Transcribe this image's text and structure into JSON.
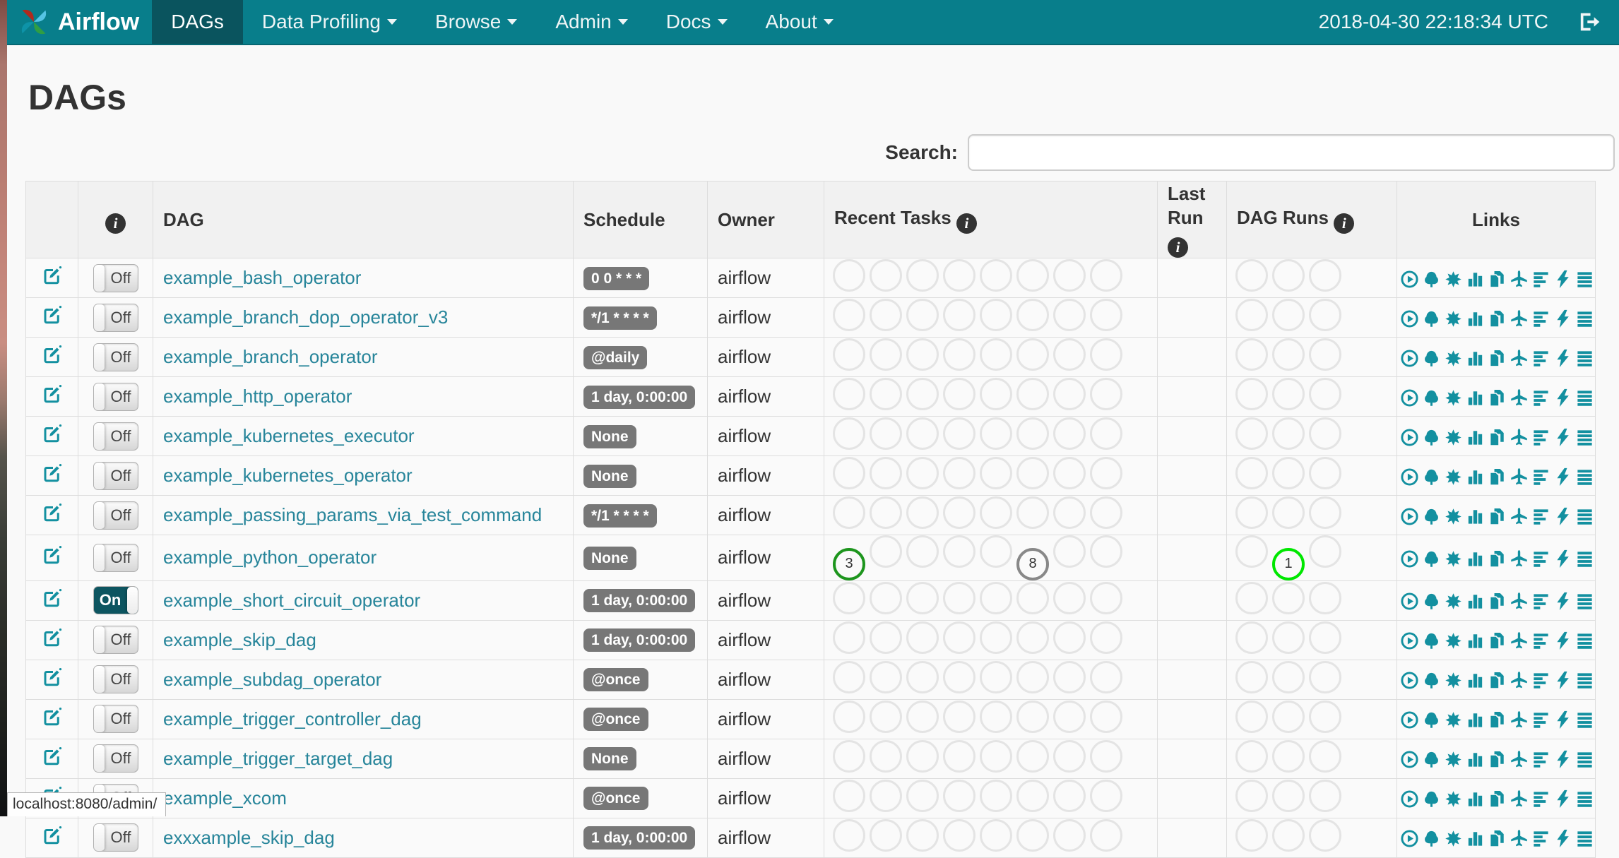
{
  "colors": {
    "navbar": "#087e8b",
    "navbar_active": "#0a545e",
    "link": "#27859a",
    "icon": "#1390a0",
    "badge_bg": "#777777",
    "toggle_on": "#0d5560",
    "task_success": "#1d951d",
    "task_none": "#888888",
    "run_running": "#00e700",
    "circle_empty": "#e4e4e4"
  },
  "navbar": {
    "logo_icon": "airflow-pinwheel-logo",
    "brand": "Airflow",
    "items": [
      {
        "label": "DAGs",
        "active": true,
        "caret": false
      },
      {
        "label": "Data Profiling",
        "active": false,
        "caret": true
      },
      {
        "label": "Browse",
        "active": false,
        "caret": true
      },
      {
        "label": "Admin",
        "active": false,
        "caret": true
      },
      {
        "label": "Docs",
        "active": false,
        "caret": true
      },
      {
        "label": "About",
        "active": false,
        "caret": true
      }
    ],
    "clock": "2018-04-30 22:18:34 UTC",
    "logout_icon": "logout-icon"
  },
  "page": {
    "title": "DAGs"
  },
  "search": {
    "label": "Search:",
    "value": ""
  },
  "table": {
    "headers": {
      "dag": "DAG",
      "schedule": "Schedule",
      "owner": "Owner",
      "recent_tasks": "Recent Tasks",
      "last_run": "Last Run",
      "dag_runs": "DAG Runs",
      "links": "Links"
    },
    "info_icon": "info-icon",
    "toggle": {
      "on_label": "On",
      "off_label": "Off"
    },
    "recent_task_slots": 8,
    "dag_run_slots": 3,
    "links": [
      "trigger-dag",
      "tree-view",
      "graph-view",
      "task-duration",
      "task-tries",
      "landing-times",
      "gantt-view",
      "code-view",
      "log-view",
      "refresh"
    ],
    "rows": [
      {
        "name": "example_bash_operator",
        "schedule": "0 0 * * *",
        "owner": "airflow",
        "enabled": false,
        "last_run": "",
        "recent_tasks": [],
        "dag_runs": []
      },
      {
        "name": "example_branch_dop_operator_v3",
        "schedule": "*/1 * * * *",
        "owner": "airflow",
        "enabled": false,
        "last_run": "",
        "recent_tasks": [],
        "dag_runs": []
      },
      {
        "name": "example_branch_operator",
        "schedule": "@daily",
        "owner": "airflow",
        "enabled": false,
        "last_run": "",
        "recent_tasks": [],
        "dag_runs": []
      },
      {
        "name": "example_http_operator",
        "schedule": "1 day, 0:00:00",
        "owner": "airflow",
        "enabled": false,
        "last_run": "",
        "recent_tasks": [],
        "dag_runs": []
      },
      {
        "name": "example_kubernetes_executor",
        "schedule": "None",
        "owner": "airflow",
        "enabled": false,
        "last_run": "",
        "recent_tasks": [],
        "dag_runs": []
      },
      {
        "name": "example_kubernetes_operator",
        "schedule": "None",
        "owner": "airflow",
        "enabled": false,
        "last_run": "",
        "recent_tasks": [],
        "dag_runs": []
      },
      {
        "name": "example_passing_params_via_test_command",
        "schedule": "*/1 * * * *",
        "owner": "airflow",
        "enabled": false,
        "last_run": "",
        "recent_tasks": [],
        "dag_runs": []
      },
      {
        "name": "example_python_operator",
        "schedule": "None",
        "owner": "airflow",
        "enabled": false,
        "last_run": "",
        "recent_tasks": [
          {
            "slot": 0,
            "count": "3",
            "color": "#1d951d"
          },
          {
            "slot": 5,
            "count": "8",
            "color": "#888888"
          }
        ],
        "dag_runs": [
          {
            "slot": 1,
            "count": "1",
            "color": "#00e700"
          }
        ]
      },
      {
        "name": "example_short_circuit_operator",
        "schedule": "1 day, 0:00:00",
        "owner": "airflow",
        "enabled": true,
        "last_run": "",
        "recent_tasks": [],
        "dag_runs": []
      },
      {
        "name": "example_skip_dag",
        "schedule": "1 day, 0:00:00",
        "owner": "airflow",
        "enabled": false,
        "last_run": "",
        "recent_tasks": [],
        "dag_runs": []
      },
      {
        "name": "example_subdag_operator",
        "schedule": "@once",
        "owner": "airflow",
        "enabled": false,
        "last_run": "",
        "recent_tasks": [],
        "dag_runs": []
      },
      {
        "name": "example_trigger_controller_dag",
        "schedule": "@once",
        "owner": "airflow",
        "enabled": false,
        "last_run": "",
        "recent_tasks": [],
        "dag_runs": []
      },
      {
        "name": "example_trigger_target_dag",
        "schedule": "None",
        "owner": "airflow",
        "enabled": false,
        "last_run": "",
        "recent_tasks": [],
        "dag_runs": []
      },
      {
        "name": "example_xcom",
        "schedule": "@once",
        "owner": "airflow",
        "enabled": false,
        "last_run": "",
        "recent_tasks": [],
        "dag_runs": []
      },
      {
        "name": "exxxample_skip_dag",
        "schedule": "1 day, 0:00:00",
        "owner": "airflow",
        "enabled": false,
        "last_run": "",
        "recent_tasks": [],
        "dag_runs": []
      }
    ]
  },
  "status_bar": {
    "text": "localhost:8080/admin/"
  }
}
